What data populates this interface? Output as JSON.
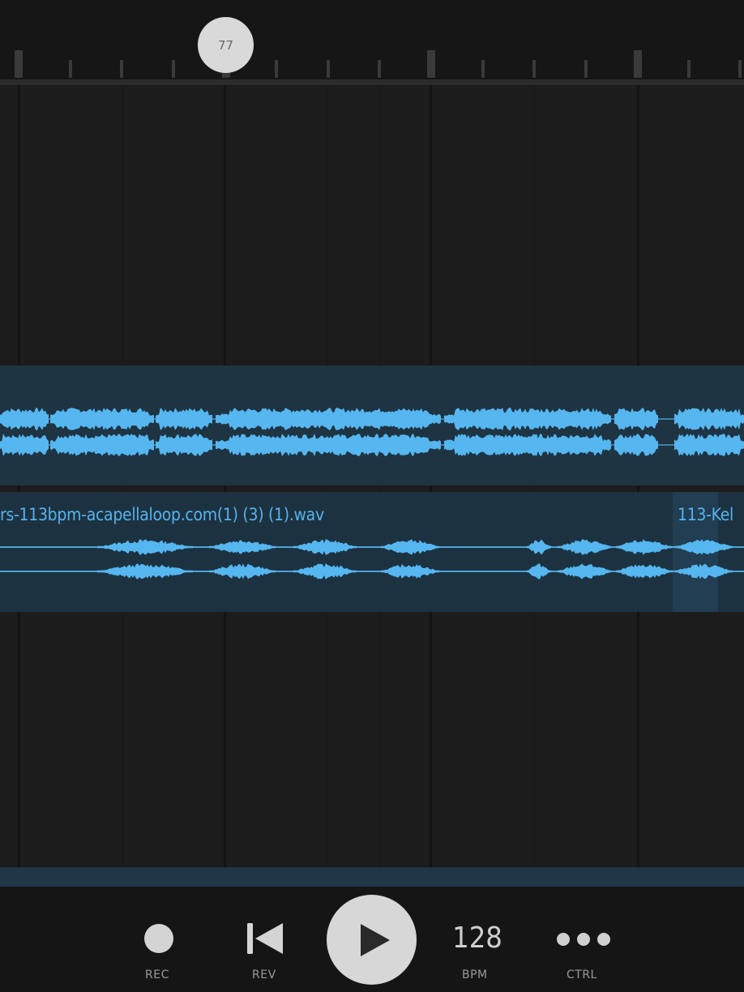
{
  "ruler": {
    "playhead_label": "77"
  },
  "tracks": {
    "clip1": {
      "name": ""
    },
    "clip2": {
      "name": "rs-113bpm-acapellaloop.com(1) (3) (1).wav",
      "name_next": "113-Kel"
    }
  },
  "transport": {
    "rec_label": "REC",
    "rev_label": "REV",
    "play_label": "",
    "bpm_value": "128",
    "bpm_label": "BPM",
    "ctrl_label": "CTRL"
  },
  "icons": {
    "record": "record-dot-icon",
    "rewind": "skip-back-icon",
    "play": "play-icon",
    "more": "more-dots-icon"
  },
  "colors": {
    "waveform": "#55b6f0",
    "clip_bg": "#1e3442",
    "background": "#1a1a1b"
  }
}
